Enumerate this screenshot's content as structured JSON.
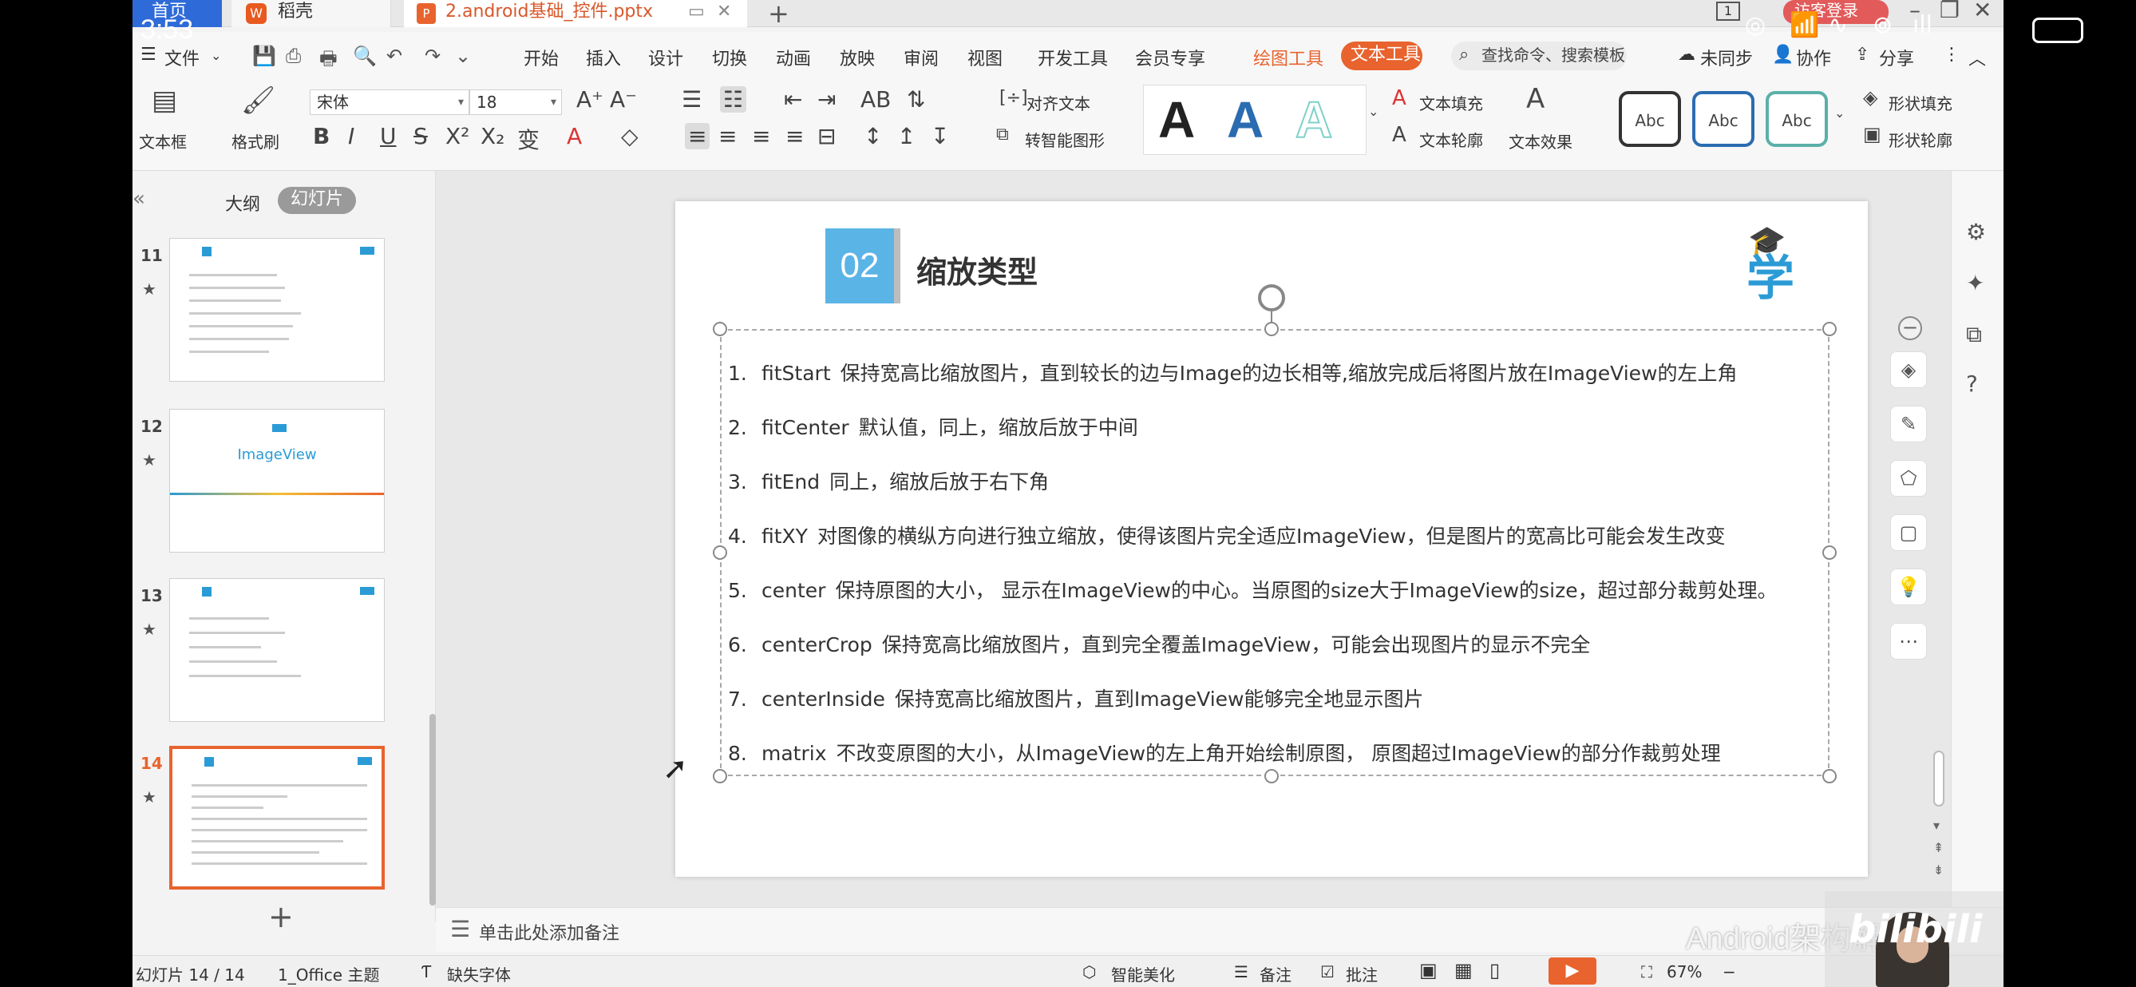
{
  "phone_status": {
    "time": "3:53"
  },
  "tabs": {
    "home": "首页",
    "wps": "稻壳",
    "wps_logo": "W",
    "doc": "2.android基础_控件.pptx",
    "doc_logo": "P",
    "add": "+",
    "login": "访客登录"
  },
  "menu": {
    "file": "文件",
    "items": [
      "开始",
      "插入",
      "设计",
      "切换",
      "动画",
      "放映",
      "审阅",
      "视图",
      "开发工具",
      "会员专享"
    ],
    "drawing_tools": "绘图工具",
    "text_tools": "文本工具",
    "search": "查找命令、搜索模板",
    "unsynced": "未同步",
    "collab": "协作",
    "share": "分享"
  },
  "ribbon": {
    "textbox": "文本框",
    "format_painter": "格式刷",
    "font_name": "宋体",
    "font_size": "18",
    "align_text": "对齐文本",
    "smart_shape": "转智能图形",
    "text_fill": "文本填充",
    "text_outline": "文本轮廓",
    "text_effect": "文本效果",
    "shape_fill": "形状填充",
    "shape_outline": "形状轮廓",
    "abc": "Abc",
    "style_letter": "A",
    "style_colors": [
      "#222222",
      "#2b6cb0",
      "#7fd1c9"
    ],
    "abc_borders": [
      "#333333",
      "#2b6cb0",
      "#5ab0a8"
    ]
  },
  "left_panel": {
    "outline": "大纲",
    "slides": "幻灯片",
    "thumbs": [
      {
        "num": "11"
      },
      {
        "num": "12",
        "title": "ImageView"
      },
      {
        "num": "13"
      },
      {
        "num": "14"
      }
    ],
    "add": "+"
  },
  "slide": {
    "number": "02",
    "title": "缩放类型",
    "brand": "学",
    "items": [
      {
        "n": "1.",
        "k": "fitStart",
        "t": "保持宽高比缩放图片，直到较长的边与Image的边长相等,缩放完成后将图片放在ImageView的左上角"
      },
      {
        "n": "2.",
        "k": "fitCenter",
        "t": "默认值，同上，缩放后放于中间"
      },
      {
        "n": "3.",
        "k": "fitEnd",
        "t": "同上，缩放后放于右下角"
      },
      {
        "n": "4.",
        "k": "fitXY",
        "t": "对图像的横纵方向进行独立缩放，使得该图片完全适应ImageView，但是图片的宽高比可能会发生改变"
      },
      {
        "n": "5.",
        "k": "center",
        "t": "保持原图的大小， 显示在ImageView的中心。当原图的size大于ImageView的size，超过部分裁剪处理。"
      },
      {
        "n": "6.",
        "k": "centerCrop",
        "t": "保持宽高比缩放图片，直到完全覆盖ImageView，可能会出现图片的显示不完全"
      },
      {
        "n": "7.",
        "k": "centerInside",
        "t": "保持宽高比缩放图片，直到ImageView能够完全地显示图片"
      },
      {
        "n": "8.",
        "k": "matrix",
        "t": "不改变原图的大小，从ImageView的左上角开始绘制原图， 原图超过ImageView的部分作裁剪处理"
      }
    ]
  },
  "notes_placeholder": "单击此处添加备注",
  "status_bar": {
    "slide_count": "幻灯片 14 / 14",
    "theme": "1_Office 主题",
    "missing_font": "缺失字体",
    "smart_beautify": "智能美化",
    "notes": "备注",
    "comments": "批注",
    "zoom": "67%"
  },
  "watermark": "Android架构解析",
  "bilibili_logo": "bilibili",
  "colors": {
    "accent": "#e8632d",
    "tab_blue": "#2f6bd8",
    "brand_blue": "#2b9bd6",
    "slide_num_bg": "#5bb4e6"
  }
}
